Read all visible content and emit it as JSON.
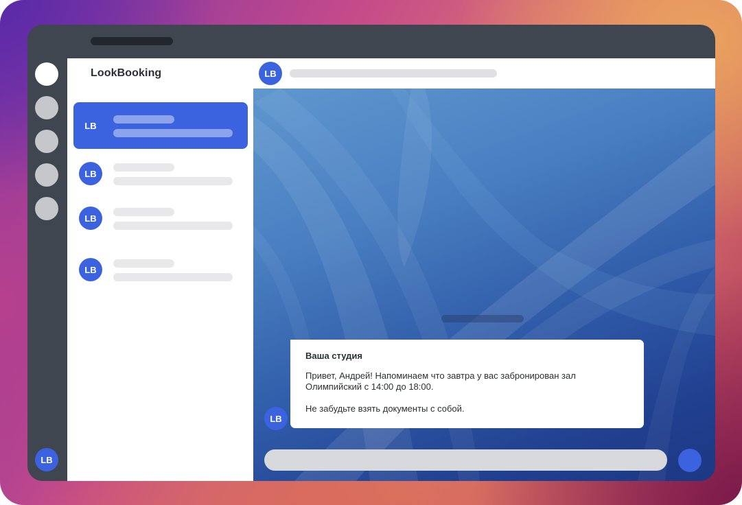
{
  "app": {
    "title": "LookBooking"
  },
  "avatar_initials": "LB",
  "chat_list": [
    {
      "initials": "LB",
      "selected": true
    },
    {
      "initials": "LB",
      "selected": false
    },
    {
      "initials": "LB",
      "selected": false
    },
    {
      "initials": "LB",
      "selected": false
    }
  ],
  "chat_header": {
    "initials": "LB"
  },
  "message": {
    "sender": "Ваша студия",
    "line1": "Привет, Андрей! Напоминаем что завтра у вас забронирован зал Олимпийский с 14:00 до 18:00.",
    "line2": "Не забудьте взять документы с собой.",
    "avatar_initials": "LB"
  },
  "colors": {
    "accent": "#3b63e0",
    "device_frame": "#3f464f",
    "chat_background": "#2f5ba8"
  }
}
